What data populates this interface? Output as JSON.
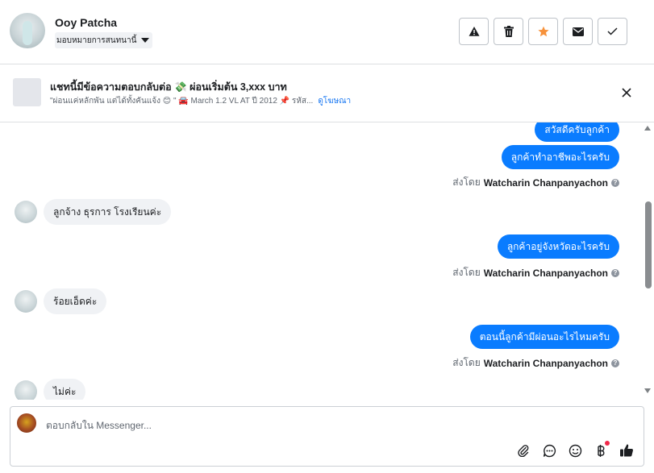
{
  "header": {
    "name": "Ooy Patcha",
    "assign_label": "มอบหมายการสนทนานี้",
    "actions": [
      {
        "icon": "warning-icon"
      },
      {
        "icon": "trash-icon"
      },
      {
        "icon": "star-icon",
        "color": "#f7923b"
      },
      {
        "icon": "envelope-icon"
      },
      {
        "icon": "check-icon"
      }
    ]
  },
  "banner": {
    "title": "แชทนี้มีข้อความตอบกลับต่อ 💸 ผ่อนเริ่มต้น 3,xxx บาท",
    "subtitle": "\"ผ่อนแค่หลักพัน แต่ได้ทั้งคันแจ้ง 😊 \" 🚘 March 1.2 VL AT ปี 2012 📌 รหัส...",
    "link": "ดูโฆษณา"
  },
  "messages": {
    "out_1": "สวัสดีครับลูกค้า",
    "out_2": "ลูกค้าทำอาชีพอะไรครับ",
    "sent_by_prefix": "ส่งโดย",
    "sender": "Watcharin Chanpanyachon",
    "in_1": "ลูกจ้าง ธุรการ โรงเรียนค่ะ",
    "out_3": "ลูกค้าอยู่จังหวัดอะไรครับ",
    "in_2": "ร้อยเอ็ดค่ะ",
    "out_4": "ตอนนี้ลูกค้ามีผ่อนอะไรไหมครับ",
    "in_3": "ไม่ค่ะ"
  },
  "composer": {
    "placeholder": "ตอบกลับใน Messenger...",
    "tools": [
      "attach-icon",
      "quick-reply-icon",
      "emoji-icon",
      "baht-icon",
      "thumbs-up-icon"
    ]
  },
  "colors": {
    "accent": "#0a7cff",
    "incoming_bubble": "#f0f2f5",
    "star": "#f7923b"
  }
}
